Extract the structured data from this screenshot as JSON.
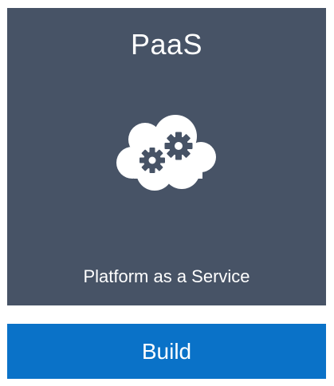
{
  "card": {
    "title": "PaaS",
    "subtitle": "Platform as a Service",
    "icon": "cloud-gears-icon",
    "background": "#475366"
  },
  "action": {
    "label": "Build",
    "background": "#0a72c8"
  }
}
